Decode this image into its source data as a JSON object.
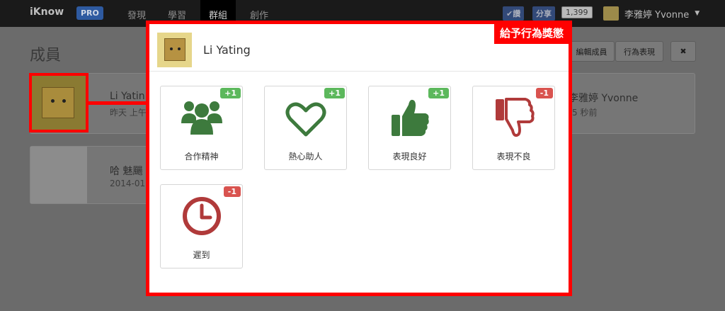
{
  "topnav": {
    "brand": "iKnow",
    "badge": "PRO",
    "links": [
      "發現",
      "學習",
      "群組",
      "創作"
    ],
    "active_index": 2,
    "fb_like": "讚",
    "fb_share": "分享",
    "fb_count": "1,399",
    "user_name": "李雅婷 Yvonne"
  },
  "background": {
    "page_title": "成員",
    "edit_members_button": "編輯成員",
    "behavior_button": "行為表現",
    "close_button": "✖",
    "member1_name": "Li Yatin",
    "member1_time": "昨天 上午",
    "member2_name": "哈 魅颺",
    "member2_time": "2014-01",
    "right_name": "李雅婷 Yvonne",
    "right_time": "5 秒前"
  },
  "modal": {
    "name": "Li Yating",
    "annotation_tag": "給予行為獎懲",
    "behaviors": [
      {
        "label": "合作精神",
        "badge": "+1",
        "type": "positive",
        "icon": "group-icon"
      },
      {
        "label": "熱心助人",
        "badge": "+1",
        "type": "positive",
        "icon": "heart-icon"
      },
      {
        "label": "表現良好",
        "badge": "+1",
        "type": "positive",
        "icon": "thumbs-up-icon"
      },
      {
        "label": "表現不良",
        "badge": "-1",
        "type": "negative",
        "icon": "thumbs-down-icon"
      },
      {
        "label": "遲到",
        "badge": "-1",
        "type": "negative",
        "icon": "clock-icon"
      }
    ]
  },
  "colors": {
    "positive": "#3d7a3d",
    "negative": "#b03a3a",
    "highlight": "#ff0000"
  }
}
